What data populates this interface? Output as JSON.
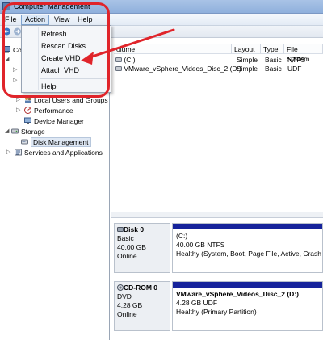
{
  "window": {
    "title": "Computer Management"
  },
  "menubar": {
    "items": [
      "File",
      "Action",
      "View",
      "Help"
    ]
  },
  "action_menu": {
    "items": [
      "Refresh",
      "Rescan Disks",
      "Create VHD",
      "Attach VHD",
      "Help"
    ]
  },
  "tree": {
    "partial_top": "Co",
    "items": [
      {
        "label": "Local Users and Groups"
      },
      {
        "label": "Performance"
      },
      {
        "label": "Device Manager"
      },
      {
        "label": "Storage"
      },
      {
        "label": "Disk Management"
      },
      {
        "label": "Services and Applications"
      }
    ]
  },
  "volume_list": {
    "columns": [
      "olume",
      "Layout",
      "Type",
      "File System"
    ],
    "rows": [
      {
        "volume": "(C:)",
        "layout": "Simple",
        "type": "Basic",
        "fs": "NTFS"
      },
      {
        "volume": "VMware_vSphere_Videos_Disc_2 (D:)",
        "layout": "Simple",
        "type": "Basic",
        "fs": "UDF"
      }
    ]
  },
  "disks": [
    {
      "name": "Disk 0",
      "kind": "Basic",
      "size": "40.00 GB",
      "status": "Online",
      "partition": {
        "name": "(C:)",
        "detail": "40.00 GB NTFS",
        "health": "Healthy (System, Boot, Page File, Active, Crash D"
      }
    },
    {
      "name": "CD-ROM 0",
      "kind": "DVD",
      "size": "4.28 GB",
      "status": "Online",
      "partition": {
        "name": "VMware_vSphere_Videos_Disc_2  (D:)",
        "detail": "4.28 GB UDF",
        "health": "Healthy (Primary Partition)"
      }
    }
  ],
  "colors": {
    "annotation": "#e0242a",
    "partition_bar": "#16239b",
    "selection": "#dfe8f4"
  },
  "icons": [
    "computer-icon",
    "back-arrow-icon",
    "forward-arrow-icon",
    "users-icon",
    "performance-icon",
    "device-manager-icon",
    "storage-icon",
    "disk-management-icon",
    "services-icon",
    "drive-icon",
    "disk-icon",
    "cdrom-icon"
  ]
}
